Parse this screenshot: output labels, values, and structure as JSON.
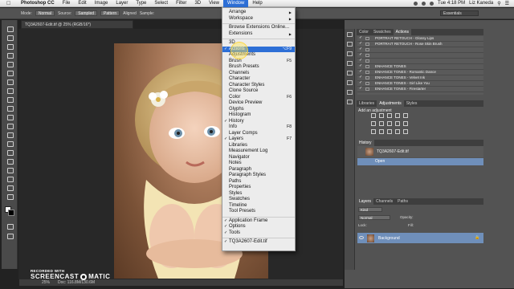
{
  "menubar": {
    "app_name": "Photoshop CC",
    "menus": [
      "File",
      "Edit",
      "Image",
      "Layer",
      "Type",
      "Select",
      "Filter",
      "3D",
      "View",
      "Window",
      "Help"
    ],
    "active_menu": "Window",
    "clock": "Tue 4:18 PM",
    "user": "Liz Kaneda"
  },
  "options_bar": {
    "mode_label": "Mode:",
    "mode_value": "Normal",
    "source_label": "Source:",
    "source_sampled": "Sampled",
    "source_pattern": "Pattern",
    "aligned_label": "Aligned",
    "sample_label": "Sample:",
    "workspace": "Essentials"
  },
  "document": {
    "tab_title": "TQ3A2607-Edit.tif @ 25% (RGB/16*)",
    "zoom": "25%",
    "doc_size": "Doc: 116.8M/130.6M"
  },
  "window_menu": {
    "items": [
      {
        "label": "Arrange",
        "submenu": true
      },
      {
        "label": "Workspace",
        "submenu": true
      },
      {
        "separator": true
      },
      {
        "label": "Browse Extensions Online..."
      },
      {
        "label": "Extensions",
        "submenu": true
      },
      {
        "separator": true
      },
      {
        "label": "3D"
      },
      {
        "label": "Actions",
        "checked": true,
        "shortcut": "⌥F9",
        "highlighted": true
      },
      {
        "label": "Adjustments"
      },
      {
        "label": "Brush",
        "shortcut": "F5"
      },
      {
        "label": "Brush Presets"
      },
      {
        "label": "Channels"
      },
      {
        "label": "Character"
      },
      {
        "label": "Character Styles"
      },
      {
        "label": "Clone Source"
      },
      {
        "label": "Color",
        "shortcut": "F6"
      },
      {
        "label": "Device Preview"
      },
      {
        "label": "Glyphs"
      },
      {
        "label": "Histogram"
      },
      {
        "label": "History",
        "checked": true
      },
      {
        "label": "Info",
        "shortcut": "F8"
      },
      {
        "label": "Layer Comps"
      },
      {
        "label": "Layers",
        "checked": true,
        "shortcut": "F7"
      },
      {
        "label": "Libraries"
      },
      {
        "label": "Measurement Log"
      },
      {
        "label": "Navigator"
      },
      {
        "label": "Notes"
      },
      {
        "label": "Paragraph"
      },
      {
        "label": "Paragraph Styles"
      },
      {
        "label": "Paths"
      },
      {
        "label": "Properties"
      },
      {
        "label": "Styles"
      },
      {
        "label": "Swatches"
      },
      {
        "label": "Timeline"
      },
      {
        "label": "Tool Presets"
      },
      {
        "separator": true
      },
      {
        "label": "Application Frame",
        "checked": true
      },
      {
        "label": "Options",
        "checked": true
      },
      {
        "label": "Tools",
        "checked": true
      },
      {
        "separator": true
      },
      {
        "label": "TQ3A2607-Edit.tif",
        "checked": true
      }
    ]
  },
  "panels": {
    "top_tabs": [
      "Color",
      "Swatches",
      "Actions"
    ],
    "actions": [
      "PORTRAIT RETOUCH - Glossy Lips",
      "PORTRAIT RETOUCH - Rose Skin Brush",
      "",
      "",
      "",
      "ENHANCE TONES",
      "ENHANCE TONES - Romantic Dance",
      "ENHANCE TONES - Velvet Ink",
      "ENHANCE TONES - Girl Like You",
      "ENHANCE TONES - Firestarter"
    ],
    "mid_tabs": [
      "Libraries",
      "Adjustments",
      "Styles"
    ],
    "add_adjustment": "Add an adjustment",
    "history_tab": "History",
    "history_snapshot": "TQ3A2607-Edit.tif",
    "history_open": "Open",
    "layers_tabs": [
      "Layers",
      "Channels",
      "Paths"
    ],
    "layers_filter": "Kind",
    "layers_blend": "Normal",
    "layers_opacity": "Opacity:",
    "layers_lock": "Lock:",
    "layers_fill": "Fill:",
    "layer_name": "Background"
  },
  "watermark": {
    "recorded": "RECORDED WITH",
    "brand_a": "SCREENCAST",
    "brand_b": "MATIC"
  }
}
